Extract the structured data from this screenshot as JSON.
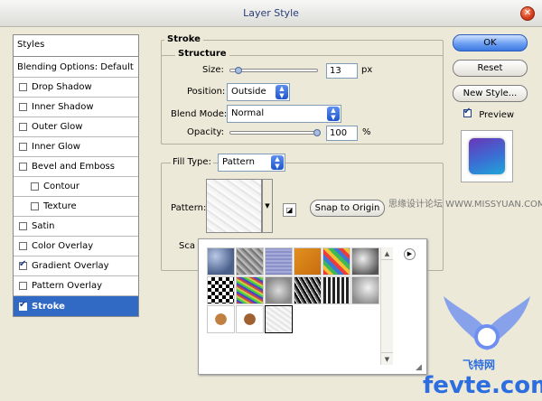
{
  "window": {
    "title": "Layer Style",
    "close_glyph": "✕"
  },
  "styles_list": {
    "header": "Styles",
    "items": [
      {
        "label": "Blending Options: Default",
        "checkbox": false,
        "checked": false,
        "indent": false,
        "active": false
      },
      {
        "label": "Drop Shadow",
        "checkbox": true,
        "checked": false,
        "indent": false,
        "active": false
      },
      {
        "label": "Inner Shadow",
        "checkbox": true,
        "checked": false,
        "indent": false,
        "active": false
      },
      {
        "label": "Outer Glow",
        "checkbox": true,
        "checked": false,
        "indent": false,
        "active": false
      },
      {
        "label": "Inner Glow",
        "checkbox": true,
        "checked": false,
        "indent": false,
        "active": false
      },
      {
        "label": "Bevel and Emboss",
        "checkbox": true,
        "checked": false,
        "indent": false,
        "active": false
      },
      {
        "label": "Contour",
        "checkbox": true,
        "checked": false,
        "indent": true,
        "active": false
      },
      {
        "label": "Texture",
        "checkbox": true,
        "checked": false,
        "indent": true,
        "active": false
      },
      {
        "label": "Satin",
        "checkbox": true,
        "checked": false,
        "indent": false,
        "active": false
      },
      {
        "label": "Color Overlay",
        "checkbox": true,
        "checked": false,
        "indent": false,
        "active": false
      },
      {
        "label": "Gradient Overlay",
        "checkbox": true,
        "checked": true,
        "indent": false,
        "active": false
      },
      {
        "label": "Pattern Overlay",
        "checkbox": true,
        "checked": false,
        "indent": false,
        "active": false
      },
      {
        "label": "Stroke",
        "checkbox": true,
        "checked": true,
        "indent": false,
        "active": true
      }
    ]
  },
  "stroke": {
    "group_title": "Stroke",
    "structure_title": "Structure",
    "size": {
      "label": "Size:",
      "value": "13",
      "unit": "px",
      "slider_fraction": 0.05
    },
    "position": {
      "label": "Position:",
      "value": "Outside"
    },
    "blend_mode": {
      "label": "Blend Mode:",
      "value": "Normal"
    },
    "opacity": {
      "label": "Opacity:",
      "value": "100",
      "unit": "%",
      "slider_fraction": 1.0
    },
    "fill_type": {
      "label": "Fill Type:",
      "value": "Pattern"
    },
    "pattern": {
      "label": "Pattern:",
      "snap_label": "Snap to Origin",
      "scale_label_partial": "Sca"
    }
  },
  "buttons": {
    "ok": "OK",
    "reset": "Reset",
    "new_style": "New Style...",
    "preview_label": "Preview",
    "preview_checked": true
  },
  "pattern_swatches": [
    "blue-bubbles",
    "gray-noise",
    "purple-fabric",
    "orange-texture",
    "rainbow-diagonal",
    "marble",
    "checkerboard",
    "colored-noise",
    "gray-blobs",
    "black-white-noise",
    "dashes",
    "gray-rocks",
    "butterfly-1",
    "butterfly-2",
    "white-texture-selected"
  ],
  "watermark": {
    "cn_text": "思缘设计论坛 WWW.MISSYUAN.COM",
    "logo_text": "fevte.com",
    "logo_cn": "飞特网"
  },
  "colors": {
    "accent": "#316ac5",
    "dialog_bg": "#ece9d8",
    "title_text": "#2a3f7a"
  }
}
